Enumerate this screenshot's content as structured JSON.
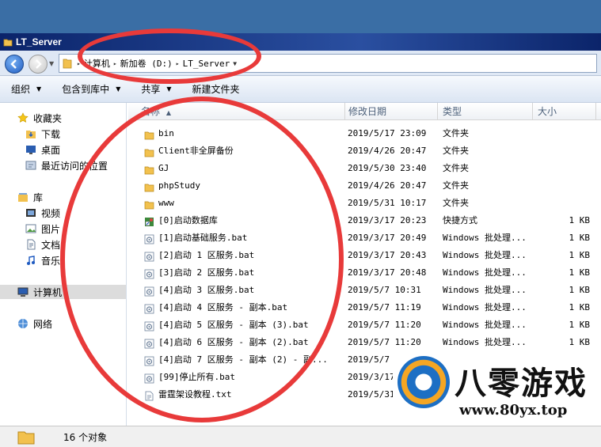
{
  "window": {
    "title": "LT_Server"
  },
  "address": {
    "crumbs": [
      "计算机",
      "新加卷 (D:)",
      "LT_Server"
    ]
  },
  "toolbar": {
    "organize": "组织",
    "include_library": "包含到库中",
    "share": "共享",
    "new_folder": "新建文件夹"
  },
  "sidebar": {
    "favorites": "收藏夹",
    "downloads": "下载",
    "desktop": "桌面",
    "recent": "最近访问的位置",
    "libraries": "库",
    "videos": "视频",
    "pictures": "图片",
    "documents": "文档",
    "music": "音乐",
    "computer": "计算机",
    "network": "网络"
  },
  "columns": {
    "name": "名称",
    "date": "修改日期",
    "type": "类型",
    "size": "大小"
  },
  "files": [
    {
      "name": "bin",
      "date": "2019/5/17 23:09",
      "type": "文件夹",
      "size": "",
      "icon": "folder-icon"
    },
    {
      "name": "Client非全屏备份",
      "date": "2019/4/26 20:47",
      "type": "文件夹",
      "size": "",
      "icon": "folder-icon"
    },
    {
      "name": "GJ",
      "date": "2019/5/30 23:40",
      "type": "文件夹",
      "size": "",
      "icon": "folder-icon"
    },
    {
      "name": "phpStudy",
      "date": "2019/4/26 20:47",
      "type": "文件夹",
      "size": "",
      "icon": "folder-icon"
    },
    {
      "name": "www",
      "date": "2019/5/31 10:17",
      "type": "文件夹",
      "size": "",
      "icon": "folder-icon"
    },
    {
      "name": "[0]启动数据库",
      "date": "2019/3/17 20:23",
      "type": "快捷方式",
      "size": "1 KB",
      "icon": "shortcut-icon"
    },
    {
      "name": "[1]启动基础服务.bat",
      "date": "2019/3/17 20:49",
      "type": "Windows 批处理...",
      "size": "1 KB",
      "icon": "batch-icon"
    },
    {
      "name": "[2]启动 1 区服务.bat",
      "date": "2019/3/17 20:43",
      "type": "Windows 批处理...",
      "size": "1 KB",
      "icon": "batch-icon"
    },
    {
      "name": "[3]启动 2 区服务.bat",
      "date": "2019/3/17 20:48",
      "type": "Windows 批处理...",
      "size": "1 KB",
      "icon": "batch-icon"
    },
    {
      "name": "[4]启动 3 区服务.bat",
      "date": "2019/5/7 10:31",
      "type": "Windows 批处理...",
      "size": "1 KB",
      "icon": "batch-icon"
    },
    {
      "name": "[4]启动 4 区服务 - 副本.bat",
      "date": "2019/5/7 11:19",
      "type": "Windows 批处理...",
      "size": "1 KB",
      "icon": "batch-icon"
    },
    {
      "name": "[4]启动 5 区服务 - 副本 (3).bat",
      "date": "2019/5/7 11:20",
      "type": "Windows 批处理...",
      "size": "1 KB",
      "icon": "batch-icon"
    },
    {
      "name": "[4]启动 6 区服务 - 副本 (2).bat",
      "date": "2019/5/7 11:20",
      "type": "Windows 批处理...",
      "size": "1 KB",
      "icon": "batch-icon"
    },
    {
      "name": "[4]启动 7 区服务 - 副本 (2) - 副...",
      "date": "2019/5/7 1",
      "type": "",
      "size": "",
      "icon": "batch-icon"
    },
    {
      "name": "[99]停止所有.bat",
      "date": "2019/3/17",
      "type": "",
      "size": "",
      "icon": "batch-icon"
    },
    {
      "name": "雷霆架设教程.txt",
      "date": "2019/5/31",
      "type": "",
      "size": "",
      "icon": "text-file-icon"
    }
  ],
  "status": {
    "count": "16 个对象"
  },
  "watermark": {
    "title": "八零游戏",
    "url": "www.80yx.top"
  },
  "colors": {
    "annotation": "#e83a3a",
    "folder": "#f2c14e",
    "titlebar": "#0b246a"
  }
}
